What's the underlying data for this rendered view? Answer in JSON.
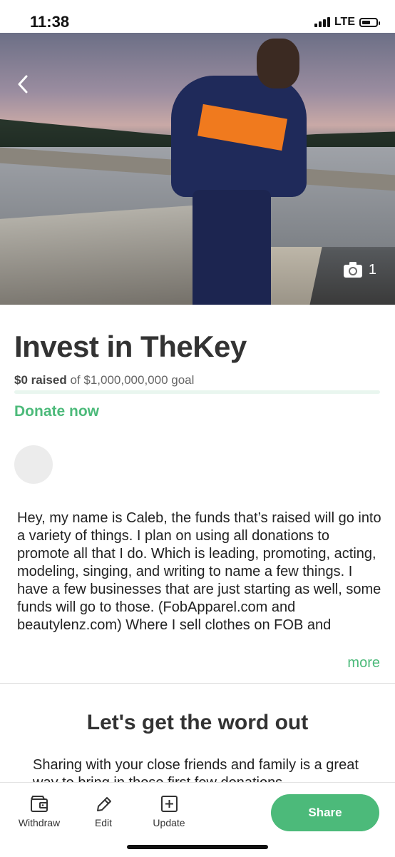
{
  "status_bar": {
    "time": "11:38",
    "network": "LTE"
  },
  "hero": {
    "photo_count": "1"
  },
  "campaign": {
    "title": "Invest in TheKey",
    "raised_amount": "$0 raised",
    "goal_text": " of $1,000,000,000 goal",
    "progress_fraction": 0,
    "donate_label": "Donate now"
  },
  "story": {
    "text": "Hey, my name is Caleb, the funds that’s raised will go into a variety of things. I plan on using all donations to promote all that I do. Which is leading, promoting, acting, modeling, singing, and writing to name a few things. I have a few businesses that are just starting as well, some funds will go to those. (FobApparel.com and beautylenz.com) Where I sell clothes on FOB and",
    "more_label": "more"
  },
  "share_section": {
    "heading": "Let's get the word out",
    "text": "Sharing with your close friends and family is a great way to bring in those first few donations"
  },
  "bottom_bar": {
    "withdraw_label": "Withdraw",
    "edit_label": "Edit",
    "update_label": "Update",
    "share_label": "Share"
  },
  "colors": {
    "accent": "#4cba7a",
    "progress_track": "#e9f6ef"
  },
  "icons": [
    "chevron-left-icon",
    "camera-icon",
    "wallet-icon",
    "pencil-icon",
    "plus-square-icon"
  ]
}
